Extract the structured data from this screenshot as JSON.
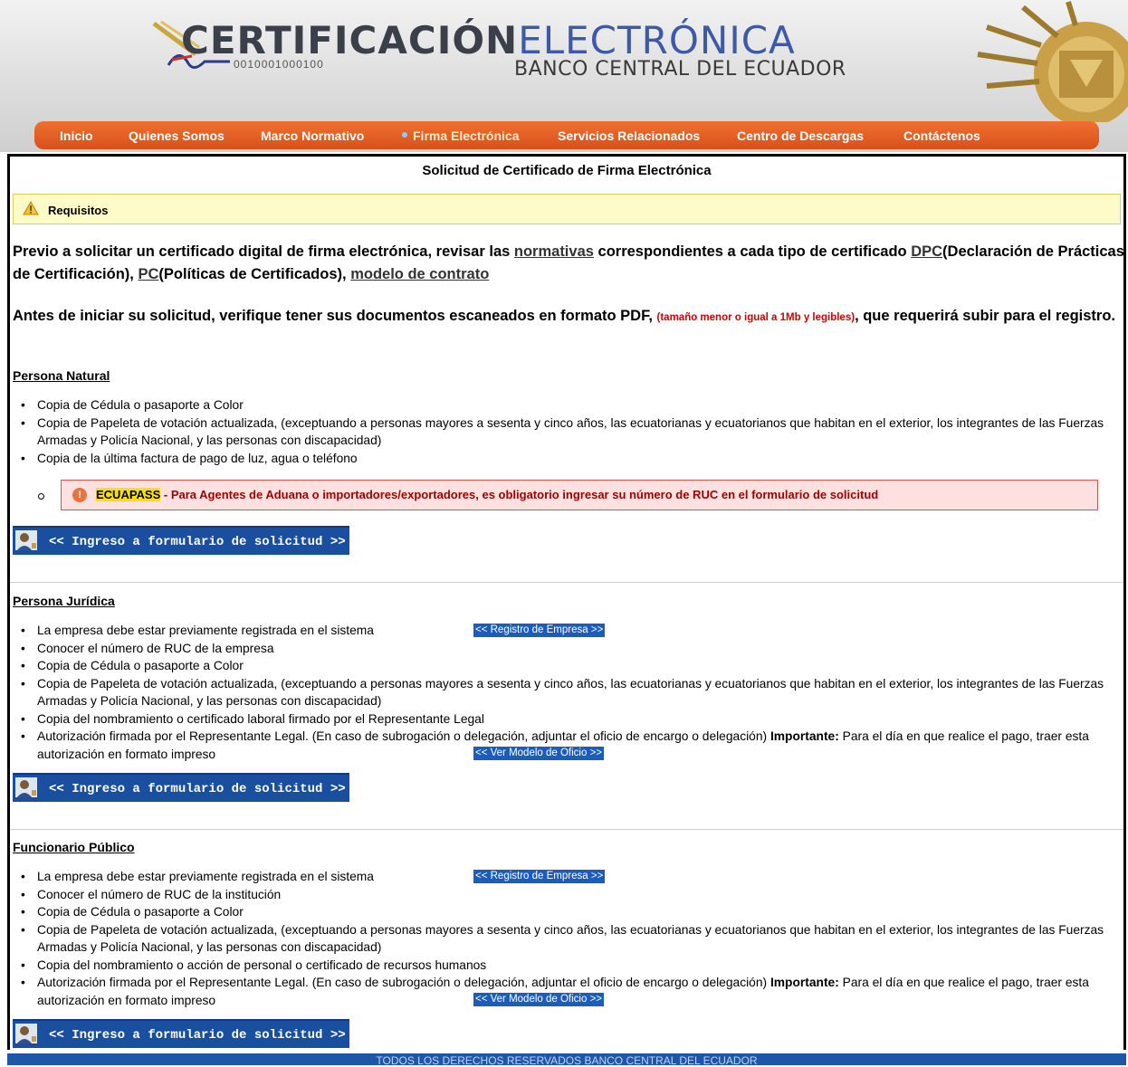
{
  "header": {
    "logo_title_a": "CERTIFICACIÓN",
    "logo_title_b": "ELECTRÓNICA",
    "logo_digits": "0010001000100",
    "logo_bank": "BANCO CENTRAL DEL ECUADOR"
  },
  "nav": [
    {
      "label": "Inicio"
    },
    {
      "label": "Quienes Somos"
    },
    {
      "label": "Marco Normativo"
    },
    {
      "label": "Firma Electrónica"
    },
    {
      "label": "Servicios Relacionados"
    },
    {
      "label": "Centro de Descargas"
    },
    {
      "label": "Contáctenos"
    }
  ],
  "main": {
    "title": "Solicitud de Certificado de Firma Electrónica",
    "requisitos": "Requisitos",
    "intro1": {
      "a": "Previo a solicitar un certificado digital de firma electrónica, revisar las ",
      "link_normativas": "normativas",
      "b": " correspondientes a cada tipo de certificado ",
      "link_dpc": "DPC",
      "c": "(Declaración de Prácticas de Certificación), ",
      "link_pc": "PC",
      "d": "(Políticas de Certificados), ",
      "link_contrato": "modelo de contrato"
    },
    "intro2": {
      "a": "Antes de iniciar su solicitud, verifique tener sus documentos escaneados en formato PDF, ",
      "small": "(tamaño menor o igual a 1Mb y legibles)",
      "b": ", que requerirá subir para el registro."
    },
    "form_button": "<< Ingreso a formulario de solicitud >>",
    "registro_empresa": "<< Registro de Empresa >>",
    "ver_modelo": "<< Ver Modelo de Oficio >>"
  },
  "natural": {
    "heading": "Persona Natural",
    "items": [
      "Copia de Cédula o pasaporte a Color",
      "Copia de Papeleta de votación actualizada, (exceptuando a personas mayores a sesenta y cinco años, las ecuatorianas y ecuatorianos que habitan en el exterior, los integrantes de las Fuerzas Armadas y Policía Nacional, y las personas con discapacidad)",
      "Copia de la última factura de pago de luz, agua o teléfono"
    ],
    "alert_highlight": "ECUAPASS",
    "alert_text": " - Para Agentes de Aduana o importadores/exportadores, es obligatorio ingresar su número de RUC en el formulario de solicitud"
  },
  "juridica": {
    "heading": "Persona Jurídica",
    "items": [
      "La empresa debe estar previamente registrada en el sistema",
      "Conocer el número de RUC de la empresa",
      "Copia de Cédula o pasaporte a Color",
      "Copia de Papeleta de votación actualizada, (exceptuando a personas mayores a sesenta y cinco años, las ecuatorianas y ecuatorianos que habitan en el exterior, los integrantes de las Fuerzas Armadas y Policía Nacional, y las personas con discapacidad)",
      "Copia del nombramiento o certificado laboral firmado por el Representante Legal"
    ],
    "auth_a": "Autorización firmada por el Representante Legal. (En caso de subrogación o delegación, adjuntar el oficio de encargo o delegación) ",
    "auth_bold": "Importante:",
    "auth_b": " Para el día en que realice el pago, traer esta autorización en formato impreso"
  },
  "funcionario": {
    "heading": "Funcionario Público",
    "items": [
      "La empresa debe estar previamente registrada en el sistema",
      "Conocer el número de RUC de la institución",
      "Copia de Cédula o pasaporte a Color",
      "Copia de Papeleta de votación actualizada, (exceptuando a personas mayores a sesenta y cinco años, las ecuatorianas y ecuatorianos que habitan en el exterior, los integrantes de las Fuerzas Armadas y Policía Nacional, y las personas con discapacidad)",
      "Copia del nombramiento o acción de personal o certificado de recursos humanos"
    ],
    "auth_a": "Autorización firmada por el Representante Legal. (En caso de subrogación o delegación, adjuntar el oficio de encargo o delegación) ",
    "auth_bold": "Importante:",
    "auth_b": " Para el día en que realice el pago, traer esta autorización en formato impreso"
  },
  "footer": {
    "text": "TODOS LOS DERECHOS RESERVADOS BANCO CENTRAL DEL ECUADOR"
  }
}
